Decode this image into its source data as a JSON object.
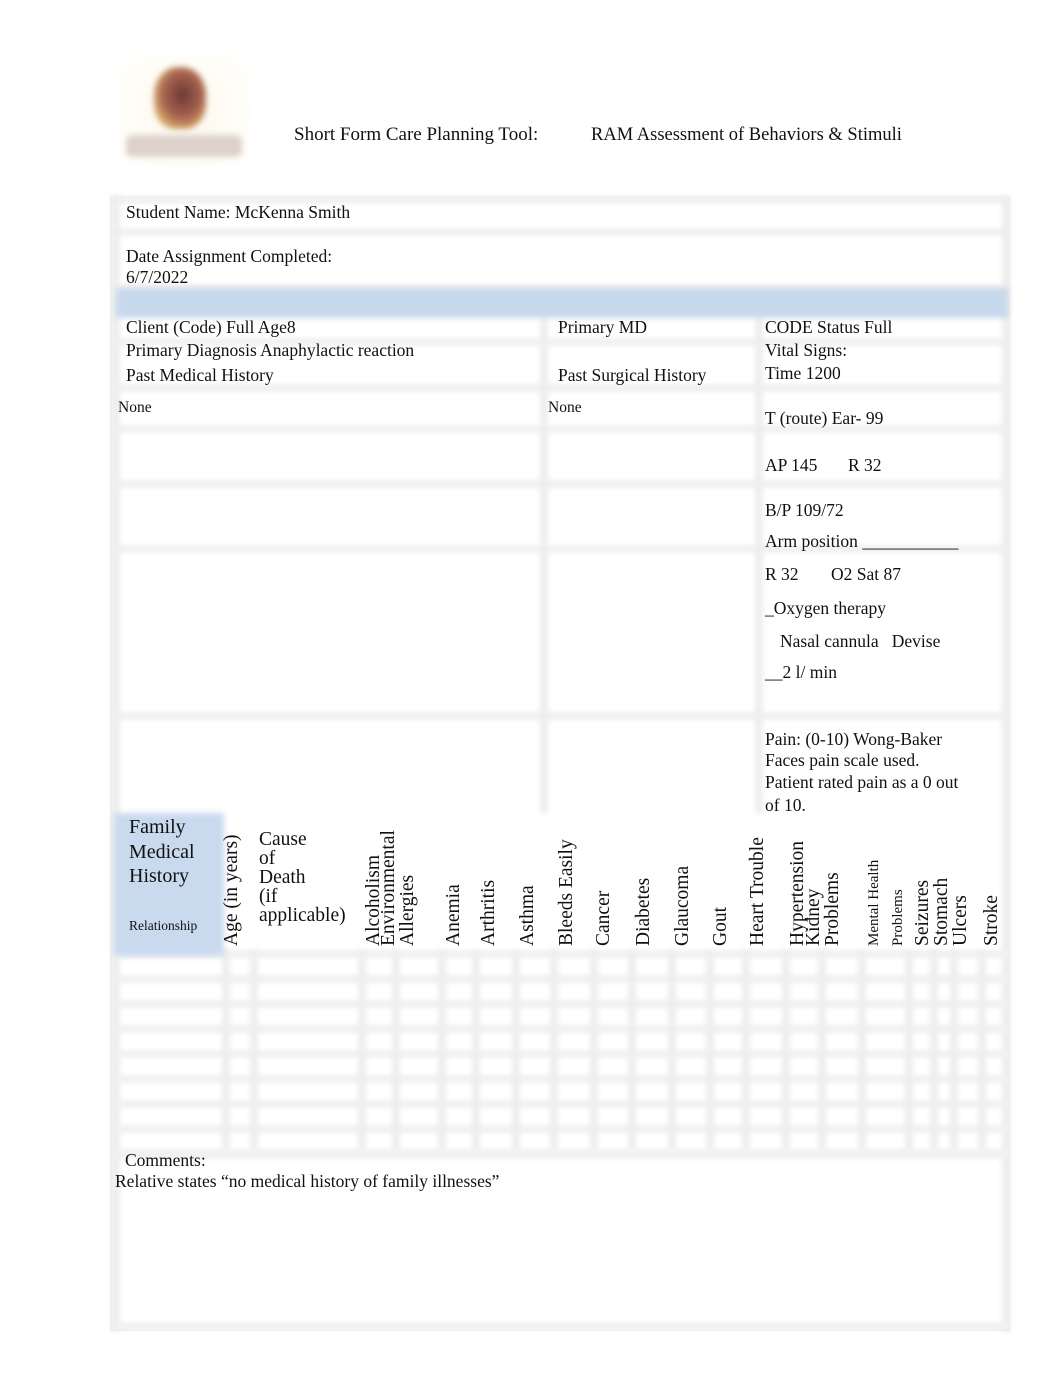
{
  "header": {
    "title": "Short Form Care Planning Tool:",
    "subtitle": "RAM Assessment of Behaviors & Stimuli",
    "logo": "school-logo"
  },
  "student": {
    "name_line": "Student Name: McKenna Smith",
    "date_label": "Date Assignment Completed:",
    "date_value": "6/7/2022"
  },
  "client": {
    "code_line": "Client (Code) Full Age8",
    "diagnosis_line": "Primary Diagnosis Anaphylactic reaction",
    "past_medical_label": "Past Medical History",
    "past_medical_value": "None",
    "primary_md_label": "Primary MD",
    "past_surgical_label": "Past Surgical History",
    "past_surgical_value": "None"
  },
  "vitals": {
    "code_status": "CODE Status Full",
    "label": "Vital Signs:",
    "time": "Time 1200",
    "temp": "T (route) Ear- 99",
    "ap": "AP 145",
    "r1": "R 32",
    "bp": "B/P 109/72",
    "arm_position": "Arm position ___________",
    "r2": "R 32",
    "o2sat": "O2 Sat 87",
    "oxygen": "_Oxygen therapy",
    "device": "Nasal cannula   Devise",
    "flow": "__2 l/ min",
    "pain": [
      "Pain: (0-10) Wong-Baker",
      "Faces pain scale used.",
      "Patient rated pain as a 0 out",
      "of 10."
    ]
  },
  "family_history": {
    "title": [
      "Family",
      "Medical",
      "History"
    ],
    "relationship_label": "Relationship",
    "age_label": "Age (in years)",
    "cause_label": [
      "Cause",
      "of",
      "Death",
      "(if",
      "applicable)"
    ],
    "conditions": [
      {
        "lines": [
          "Alcoholism"
        ]
      },
      {
        "lines": [
          "Environmental",
          "Allergies"
        ]
      },
      {
        "lines": [
          "Anemia"
        ]
      },
      {
        "lines": [
          "Arthritis"
        ]
      },
      {
        "lines": [
          "Asthma"
        ]
      },
      {
        "lines": [
          "Bleeds Easily"
        ]
      },
      {
        "lines": [
          "Cancer"
        ]
      },
      {
        "lines": [
          "Diabetes"
        ]
      },
      {
        "lines": [
          "Glaucoma"
        ]
      },
      {
        "lines": [
          "Gout"
        ]
      },
      {
        "lines": [
          "Heart Trouble"
        ]
      },
      {
        "lines": [
          "Hypertension"
        ]
      },
      {
        "lines": [
          "Kidney",
          "Problems"
        ]
      },
      {
        "lines": [
          "Mental Health"
        ],
        "small": true
      },
      {
        "lines": [
          "Problems"
        ],
        "small": true
      },
      {
        "lines": [
          "Seizures"
        ]
      },
      {
        "lines": [
          "Stomach",
          "Ulcers"
        ]
      },
      {
        "lines": [
          "Stroke"
        ]
      }
    ],
    "empty_rows": 8
  },
  "comments": {
    "label": "Comments:",
    "text": "Relative states “no medical history of family illnesses”"
  }
}
